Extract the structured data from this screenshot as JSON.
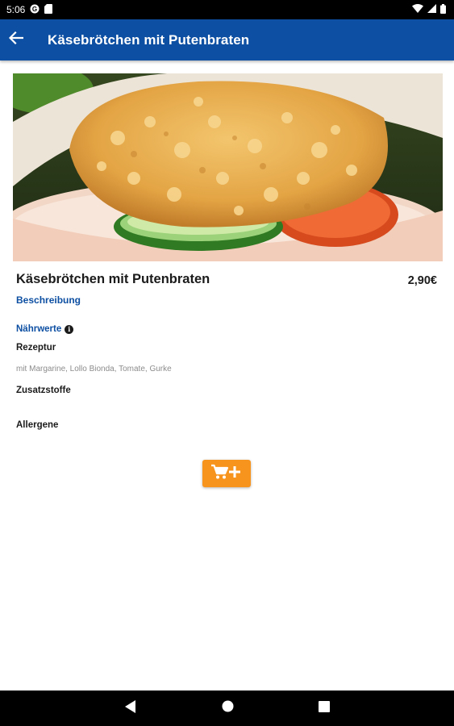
{
  "status_bar": {
    "time": "5:06",
    "icons": [
      "google-icon",
      "sd-card-icon",
      "wifi-icon",
      "signal-icon",
      "battery-icon"
    ]
  },
  "app_bar": {
    "title": "Käsebrötchen mit Putenbraten",
    "back_icon": "arrow-left-icon",
    "color": "#0d4fa2"
  },
  "product": {
    "image_icon": "sandwich-photo",
    "name": "Käsebrötchen mit Putenbraten",
    "price": "2,90€",
    "description_link": "Beschreibung",
    "nutrition_label": "Nährwerte",
    "recipe_heading": "Rezeptur",
    "recipe_text": "mit Margarine, Lollo Bionda, Tomate, Gurke",
    "additives_heading": "Zusatzstoffe",
    "allergens_heading": "Allergene"
  },
  "cart": {
    "icon": "cart-add-icon",
    "color": "#f7941d"
  },
  "nav_bar": {
    "icons": [
      "back-triangle-icon",
      "home-circle-icon",
      "recents-square-icon"
    ]
  }
}
